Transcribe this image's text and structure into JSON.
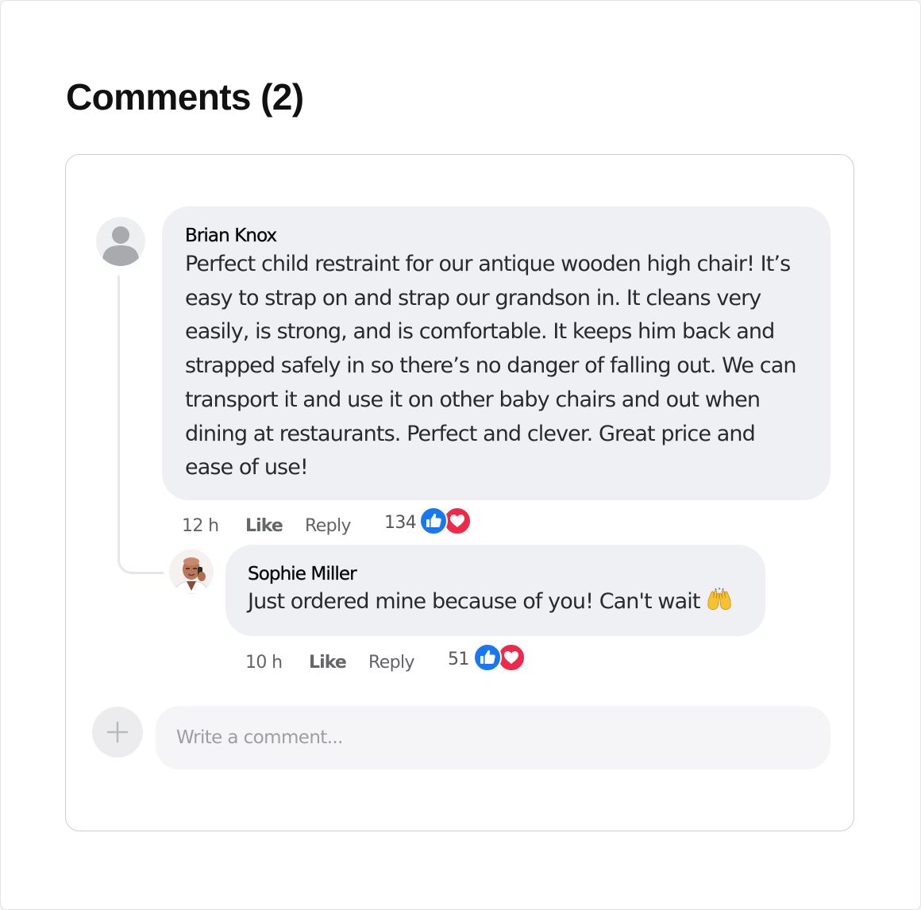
{
  "header": {
    "title": "Comments (2)"
  },
  "comments": [
    {
      "author": "Brian Knox",
      "text": "Perfect child restraint for our antique wooden high chair! It’s easy to strap on and strap our grandson in. It cleans very easily, is strong, and is comfortable. It keeps him back and strapped safely in so there’s no danger of falling out. We can transport it and use it on other baby chairs and out when dining at restaurants. Perfect and clever. Great price and ease of use!",
      "time": "12 h",
      "like_label": "Like",
      "reply_label": "Reply",
      "reaction_count": "134",
      "avatar_icon": "default-user-icon",
      "reaction_icons": [
        "thumbs-up-icon",
        "heart-icon"
      ]
    },
    {
      "author": "Sophie Miller",
      "text": "Just ordered mine because of you! Can't wait",
      "emoji": "raising-hands-emoji",
      "time": "10 h",
      "like_label": "Like",
      "reply_label": "Reply",
      "reaction_count": "51",
      "avatar_icon": "user-photo",
      "reaction_icons": [
        "thumbs-up-icon",
        "heart-icon"
      ]
    }
  ],
  "composer": {
    "placeholder": "Write a comment...",
    "add_icon": "plus-icon"
  },
  "colors": {
    "bubble": "#eff0f4",
    "like_blue": "#1877f2",
    "love_red": "#f02849",
    "card_border": "#cfcfd2",
    "thread_line": "#e4e6ea"
  }
}
